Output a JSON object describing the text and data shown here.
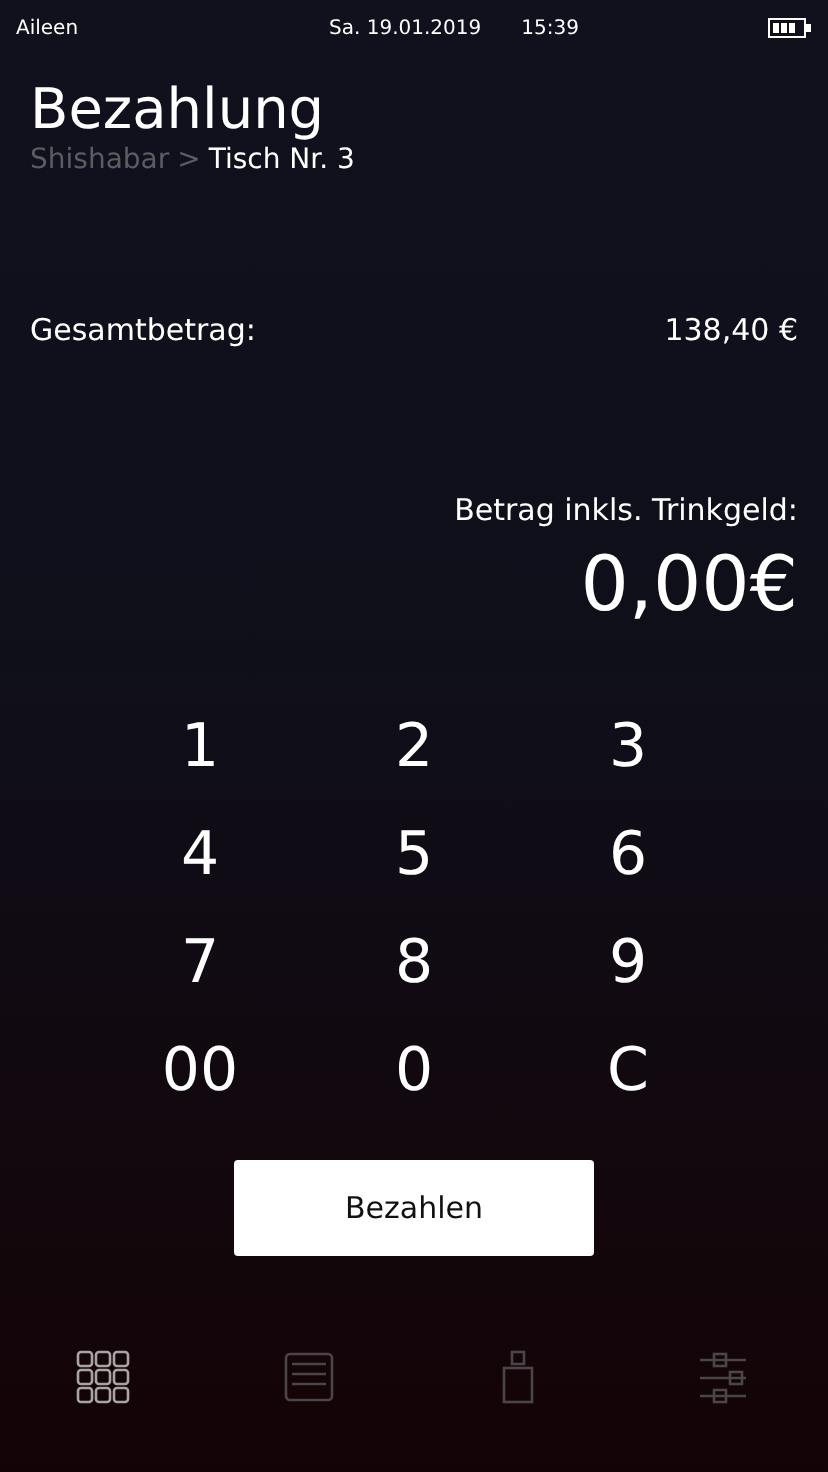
{
  "status_bar": {
    "user": "Aileen",
    "date": "Sa. 19.01.2019",
    "time": "15:39"
  },
  "header": {
    "title": "Bezahlung",
    "breadcrumb": [
      {
        "label": "Shishabar",
        "current": false
      },
      {
        "label": "Tisch Nr. 3",
        "current": true
      }
    ],
    "separator": ">"
  },
  "total": {
    "label": "Gesamtbetrag:",
    "value": "138,40 €"
  },
  "tip_amount": {
    "label": "Betrag inkls. Trinkgeld:",
    "value": "0,00€"
  },
  "keypad": [
    "1",
    "2",
    "3",
    "4",
    "5",
    "6",
    "7",
    "8",
    "9",
    "00",
    "0",
    "C"
  ],
  "pay_button": "Bezahlen",
  "tab_bar": [
    {
      "kind": "grid",
      "selected": true
    },
    {
      "kind": "list",
      "selected": false
    },
    {
      "kind": "bottle",
      "selected": false
    },
    {
      "kind": "sliders",
      "selected": false
    }
  ]
}
